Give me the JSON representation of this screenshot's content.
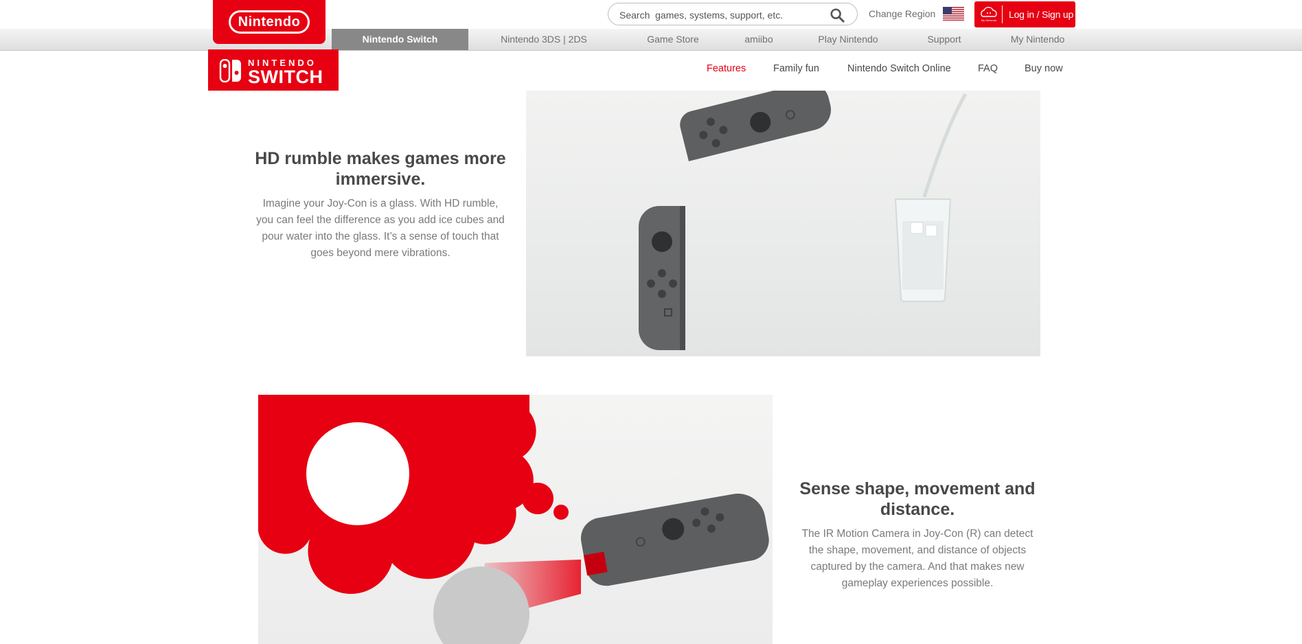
{
  "header": {
    "logo_text": "Nintendo",
    "search_placeholder": "Search  games, systems, support, etc.",
    "region_label": "Change Region",
    "login_label": "Log in / Sign up",
    "login_icon_text": "My Nintendo"
  },
  "global_nav": [
    {
      "label": "Nintendo Switch",
      "active": true
    },
    {
      "label": "Nintendo 3DS | 2DS"
    },
    {
      "label": "Game Store"
    },
    {
      "label": "amiibo"
    },
    {
      "label": "Play Nintendo"
    },
    {
      "label": "Support"
    },
    {
      "label": "My Nintendo"
    }
  ],
  "switch_logo": {
    "line1": "NINTENDO",
    "line2": "SWITCH"
  },
  "sub_nav": [
    {
      "label": "Features",
      "active": true
    },
    {
      "label": "Family fun"
    },
    {
      "label": "Nintendo Switch Online"
    },
    {
      "label": "FAQ"
    },
    {
      "label": "Buy now"
    }
  ],
  "sections": [
    {
      "title": "HD rumble makes games more immersive.",
      "body": "Imagine your Joy-Con is a glass. With HD rumble, you can feel the difference as you add ice cubes and pour water into the glass. It’s a sense of touch that goes beyond mere vibrations."
    },
    {
      "title": "Sense shape, movement and distance.",
      "body": "The IR Motion Camera in Joy-Con (R) can detect the shape, movement, and distance of objects captured by the camera. And that makes new gameplay experiences possible."
    }
  ],
  "colors": {
    "brand_red": "#e60012",
    "nav_active_bg": "#888888"
  }
}
